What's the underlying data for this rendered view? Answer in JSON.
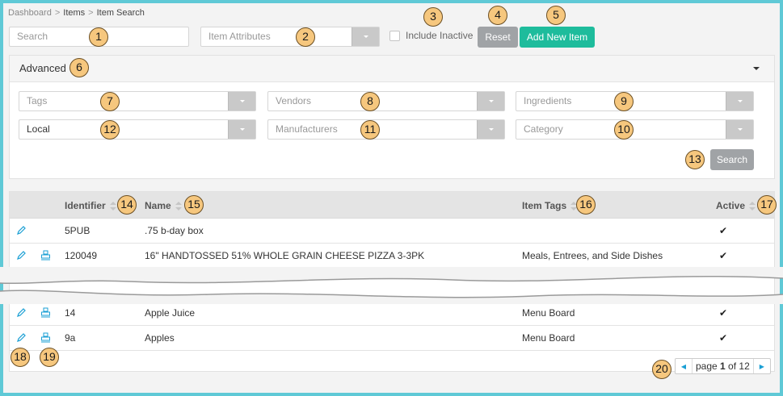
{
  "breadcrumb": {
    "items": [
      "Dashboard",
      "Items",
      "Item Search"
    ],
    "separator": ">"
  },
  "toolbar": {
    "search_placeholder": "Search",
    "item_attributes_placeholder": "Item Attributes",
    "include_inactive_label": "Include Inactive",
    "reset_label": "Reset",
    "add_new_item_label": "Add New Item"
  },
  "advanced": {
    "title": "Advanced",
    "filters": {
      "tags": "Tags",
      "vendors": "Vendors",
      "ingredients": "Ingredients",
      "local": "Local",
      "manufacturers": "Manufacturers",
      "category": "Category"
    },
    "search_label": "Search"
  },
  "table": {
    "columns": {
      "identifier": "Identifier",
      "name": "Name",
      "item_tags": "Item Tags",
      "active": "Active"
    },
    "rows": [
      {
        "identifier": "5PUB",
        "name": ".75 b-day box",
        "tags": "",
        "active": "✔",
        "has_print": false
      },
      {
        "identifier": "120049",
        "name": "16\" HANDTOSSED 51% WHOLE GRAIN CHEESE PIZZA 3-3PK",
        "tags": "Meals, Entrees, and Side Dishes",
        "active": "✔",
        "has_print": true
      },
      {
        "identifier": "14",
        "name": "Apple Juice",
        "tags": "Menu Board",
        "active": "✔",
        "has_print": true
      },
      {
        "identifier": "9a",
        "name": "Apples",
        "tags": "Menu Board",
        "active": "✔",
        "has_print": true
      }
    ]
  },
  "pagination": {
    "prefix": "page ",
    "current": "1",
    "middle": " of ",
    "total": "12"
  },
  "callouts": [
    "1",
    "2",
    "3",
    "4",
    "5",
    "6",
    "7",
    "8",
    "9",
    "10",
    "11",
    "12",
    "13",
    "14",
    "15",
    "16",
    "17",
    "18",
    "19",
    "20"
  ],
  "colors": {
    "accent_green": "#1ebc9c",
    "grey_button": "#a0a3a6",
    "border_frame": "#5fc9d6",
    "icon_blue": "#1a9fd4",
    "callout_fill": "#f6c77e"
  }
}
